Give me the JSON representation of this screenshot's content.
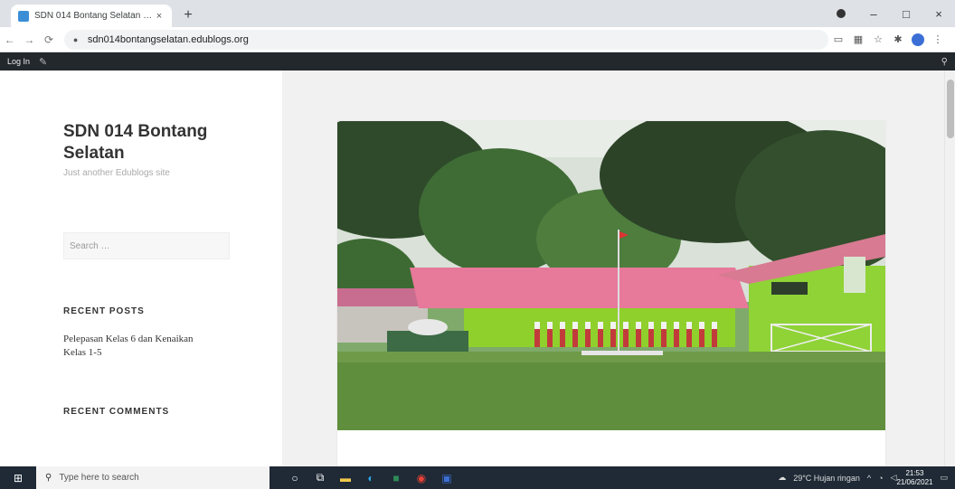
{
  "browser": {
    "tab_title": "SDN 014 Bontang Selatan – Just",
    "tab_close": "×",
    "new_tab": "+",
    "url": "sdn014bontangselatan.edublogs.org",
    "window_minimize": "–",
    "window_maximize": "□",
    "window_close": "×"
  },
  "adminbar": {
    "login_label": "Log In"
  },
  "site": {
    "title": "SDN 014 Bontang Selatan",
    "description": "Just another Edublogs site"
  },
  "sidebar": {
    "search_placeholder": "Search …",
    "recent_posts_title": "RECENT POSTS",
    "recent_posts": [
      {
        "label": "Pelepasan Kelas 6 dan Kenaikan Kelas 1-5"
      }
    ],
    "recent_comments_title": "RECENT COMMENTS"
  },
  "taskbar": {
    "search_placeholder": "Type here to search",
    "weather": "29°C Hujan ringan",
    "time": "21:53",
    "date": "21/06/2021"
  },
  "colors": {
    "adminbar_bg": "#23282d",
    "taskbar_bg": "#1f2a36",
    "accent": "#3b8fd6"
  }
}
